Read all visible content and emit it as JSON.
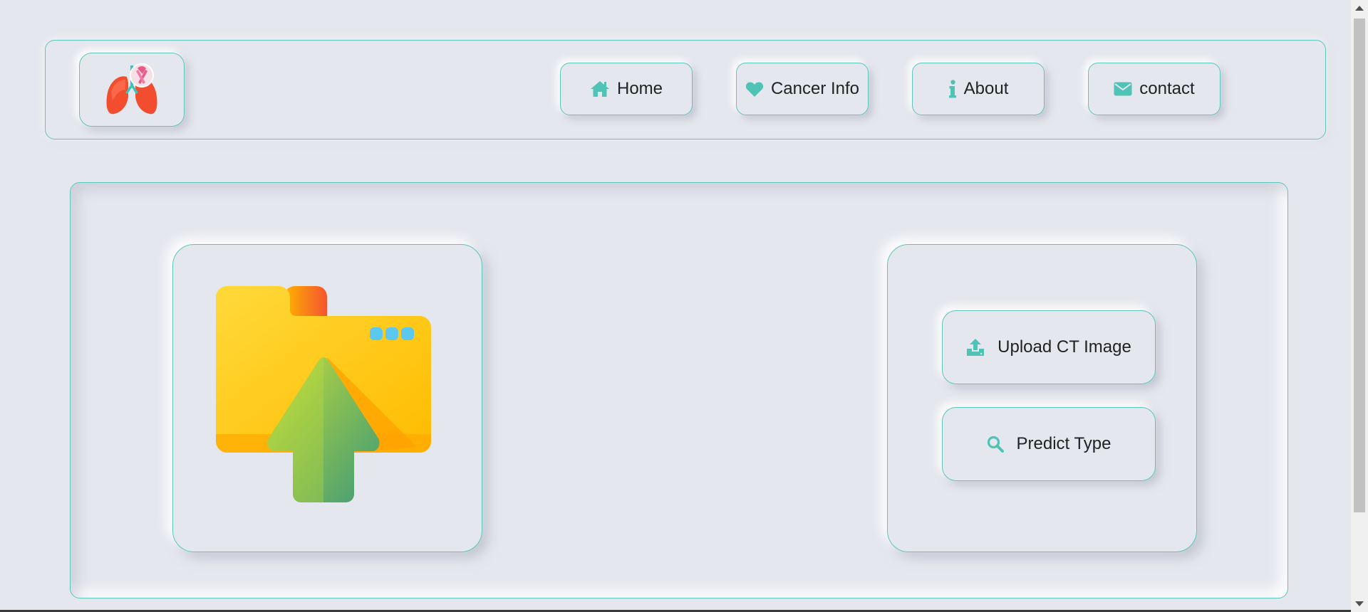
{
  "colors": {
    "accent": "#4fc3b6",
    "background": "#e5e7ee",
    "border": "#5cc6bb",
    "text": "#222222"
  },
  "navbar": {
    "logo_icon": "lungs-ribbon-logo",
    "items": [
      {
        "label": "Home",
        "icon": "home-icon"
      },
      {
        "label": "Cancer Info",
        "icon": "heart-icon"
      },
      {
        "label": "About",
        "icon": "info-icon"
      },
      {
        "label": "contact",
        "icon": "envelope-icon"
      }
    ]
  },
  "main": {
    "preview_icon": "folder-upload-icon",
    "actions": {
      "upload_label": "Upload CT Image",
      "upload_icon": "upload-icon",
      "predict_label": "Predict Type",
      "predict_icon": "search-icon"
    }
  }
}
